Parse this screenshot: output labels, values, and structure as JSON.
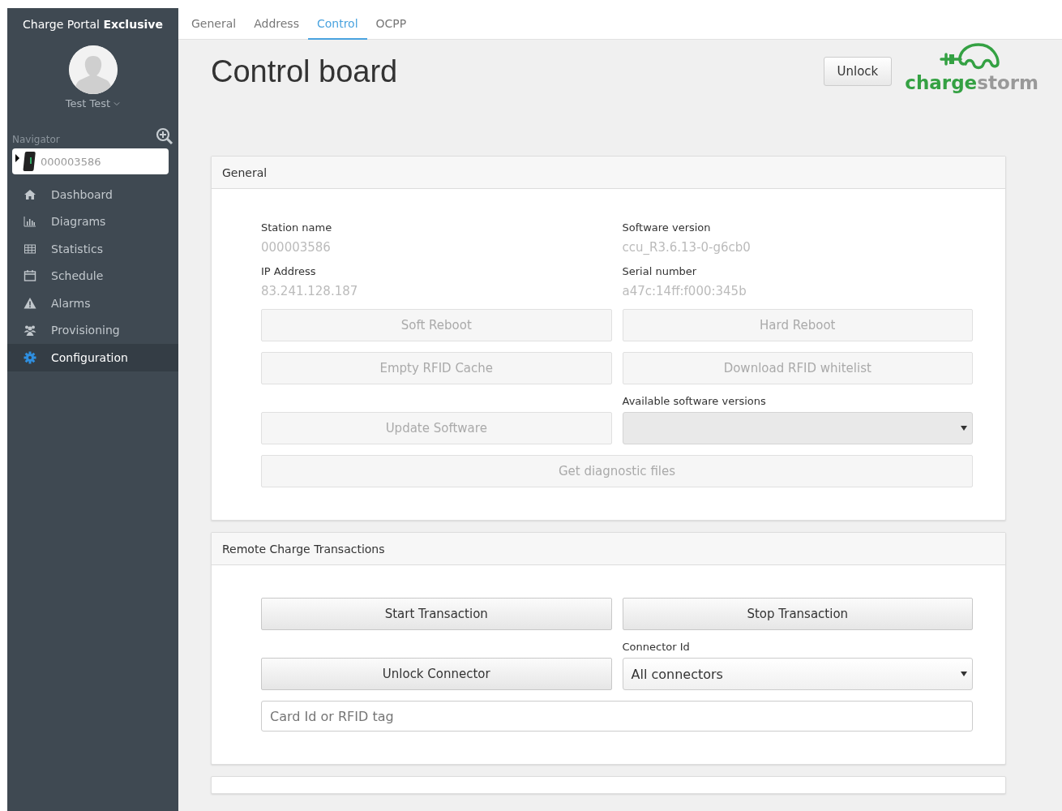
{
  "sidebar": {
    "brand": "Charge Portal **Exclusive**",
    "user": {
      "name": "Test Test"
    },
    "navigator": {
      "label": "Navigator",
      "station": "000003586"
    },
    "items": [
      {
        "label": "Dashboard",
        "selected": false
      },
      {
        "label": "Diagrams",
        "selected": false
      },
      {
        "label": "Statistics",
        "selected": false
      },
      {
        "label": "Schedule",
        "selected": false
      },
      {
        "label": "Alarms",
        "selected": false
      },
      {
        "label": "Provisioning",
        "selected": false
      },
      {
        "label": "Configuration",
        "selected": true
      }
    ]
  },
  "tabs": [
    {
      "label": "General",
      "selected": false
    },
    {
      "label": "Address",
      "selected": false
    },
    {
      "label": "Control",
      "selected": true
    },
    {
      "label": "OCPP",
      "selected": false
    }
  ],
  "header": {
    "title": "Control board",
    "unlock_button": "Unlock",
    "logo": {
      "part_1": "charge",
      "part_2": "storm"
    }
  },
  "panels": [
    {
      "title": "General",
      "rows": [
        {
          "kind": "info",
          "items": [
            {
              "label": "Station name",
              "value": "000003586"
            },
            {
              "label": "Software version",
              "value": "ccu_R3.6.13-0-g6cb0"
            }
          ]
        },
        {
          "kind": "info",
          "items": [
            {
              "label": "IP Address",
              "value": "83.241.128.187"
            },
            {
              "label": "Serial number",
              "value": "a47c:14ff:f000:345b"
            }
          ]
        },
        {
          "kind": "buttons",
          "items": [
            {
              "label": "Soft Reboot",
              "disabled": true
            },
            {
              "label": "Hard Reboot",
              "disabled": true
            }
          ]
        },
        {
          "kind": "buttons",
          "items": [
            {
              "label": "Empty RFID Cache",
              "disabled": true
            },
            {
              "label": "Download RFID whitelist",
              "disabled": true
            }
          ]
        },
        {
          "kind": "button_select",
          "button": {
            "label": "Update Software",
            "disabled": true
          },
          "select": {
            "label": "Available software versions",
            "disabled": true
          }
        },
        {
          "kind": "wide_button",
          "button": {
            "label": "Get diagnostic files",
            "disabled": true
          }
        }
      ]
    },
    {
      "title": "Remote Charge Transactions",
      "rows": [
        {
          "kind": "buttons",
          "items": [
            {
              "label": "Start Transaction",
              "disabled": false
            },
            {
              "label": "Stop Transaction",
              "disabled": false
            }
          ]
        },
        {
          "kind": "button_select",
          "button": {
            "label": "Unlock Connector",
            "disabled": false
          },
          "select": {
            "label": "Connector Id",
            "value": "All connectors",
            "disabled": false
          }
        },
        {
          "kind": "input",
          "placeholder": "Card Id or RFID tag"
        }
      ]
    }
  ],
  "next_panel_cut_off": true
}
